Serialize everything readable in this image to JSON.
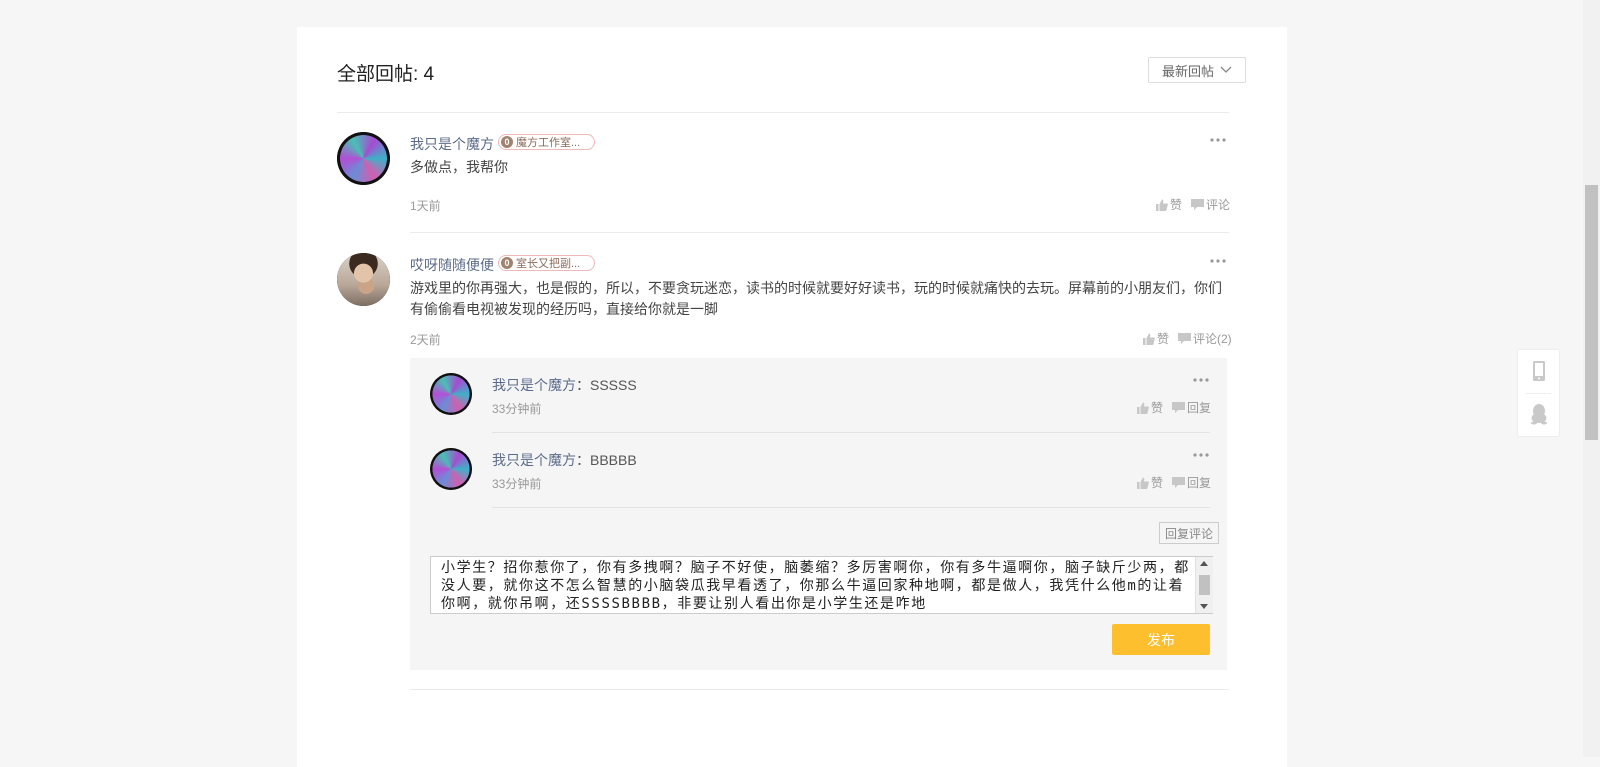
{
  "header": {
    "title": "全部回帖: 4",
    "sort_label": "最新回帖"
  },
  "posts": [
    {
      "username": "我只是个魔方",
      "badge_level": "0",
      "badge_text": "魔方工作室...",
      "content": "多做点，我帮你",
      "time": "1天前",
      "like_label": "赞",
      "comment_label": "评论"
    },
    {
      "username": "哎呀随随便便",
      "badge_level": "0",
      "badge_text": "室长又把副...",
      "content": "游戏里的你再强大，也是假的，所以，不要贪玩迷恋，读书的时候就要好好读书，玩的时候就痛快的去玩。屏幕前的小朋友们，你们有偷偷看电视被发现的经历吗，直接给你就是一脚",
      "time": "2天前",
      "like_label": "赞",
      "comment_label": "评论(2)"
    }
  ],
  "replies": [
    {
      "username": "我只是个魔方",
      "text": "：SSSSS",
      "time": "33分钟前",
      "like_label": "赞",
      "reply_label": "回复"
    },
    {
      "username": "我只是个魔方",
      "text": "：BBBBB",
      "time": "33分钟前",
      "like_label": "赞",
      "reply_label": "回复"
    }
  ],
  "reply_editor": {
    "reply_comment_label": "回复评论",
    "value": "小学生？招你惹你了，你有多拽啊？脑子不好使，脑萎缩？多厉害啊你，你有多牛逼啊你，脑子缺斤少两，都没人要，就你这不怎么智慧的小脑袋瓜我早看透了，你那么牛逼回家种地啊，都是做人，我凭什么他m的让着你啊，就你吊啊，还SSSSBBBB，非要让别人看出你是小学生还是咋地",
    "publish_label": "发布"
  },
  "colors": {
    "accent": "#fdbf2d",
    "username": "#5d6b8a",
    "badge_border": "#f0b8b8"
  },
  "icons": [
    "chevron-down-icon",
    "more-icon",
    "thumbs-up-icon",
    "comment-icon",
    "mobile-icon",
    "qq-penguin-icon"
  ]
}
